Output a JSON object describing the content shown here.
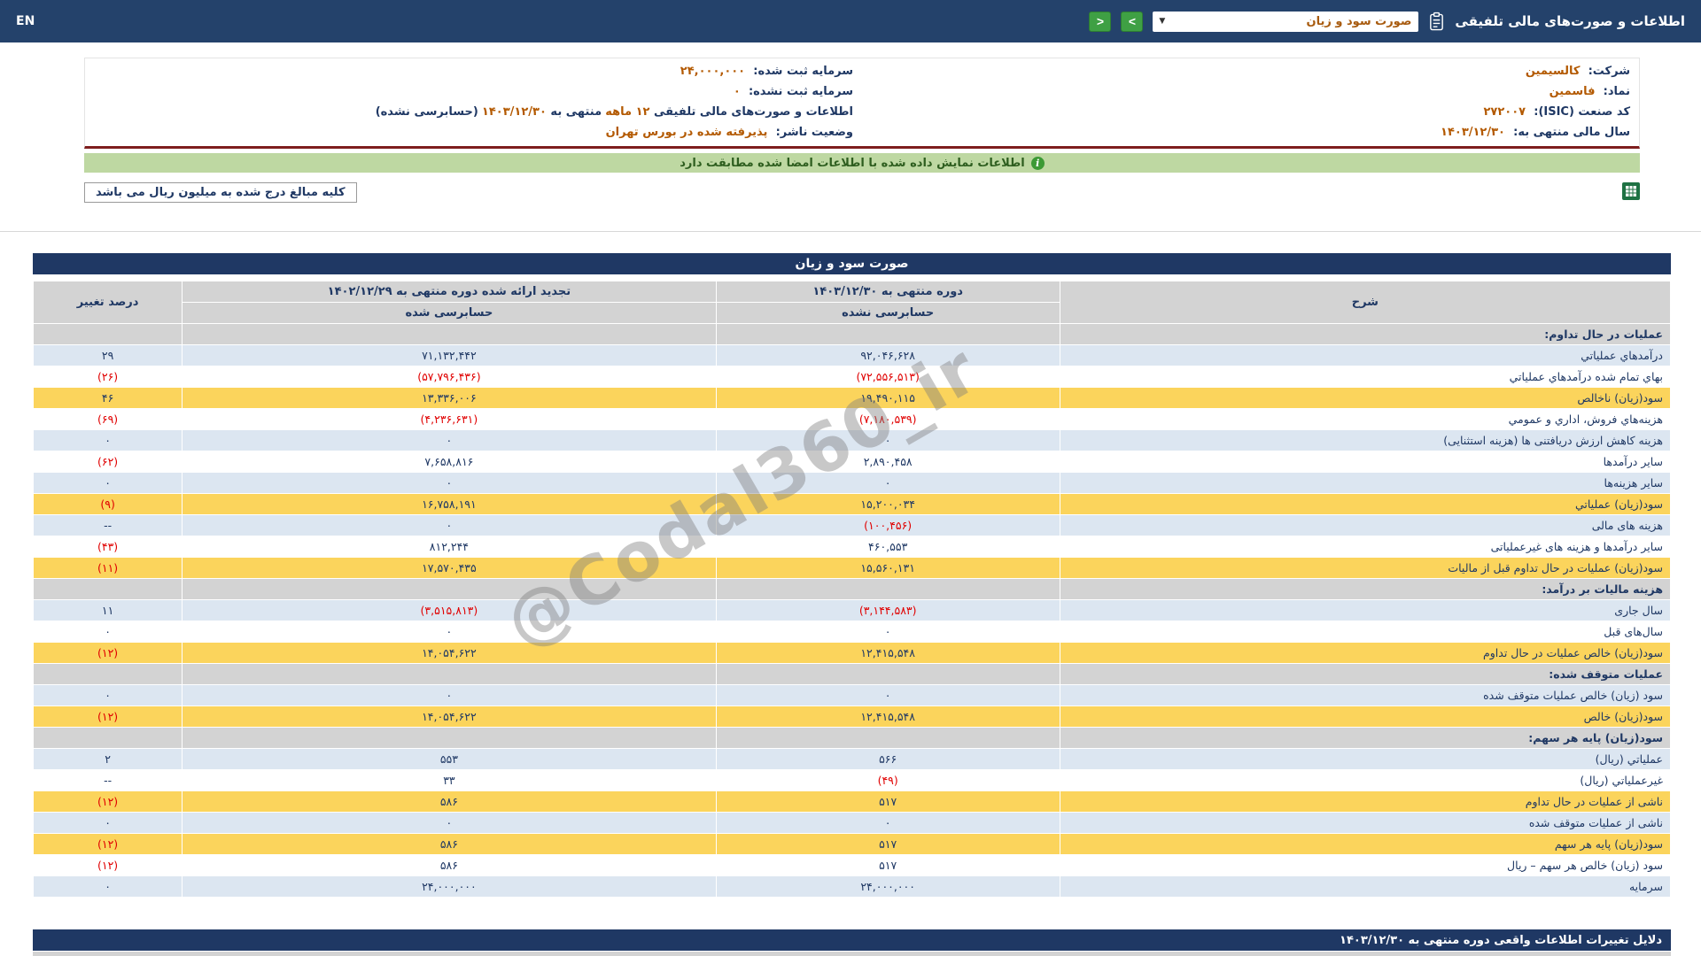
{
  "colors": {
    "navy_bar": "#1F3864",
    "topbar_navy": "#24426B",
    "accent_orange": "#B35900",
    "row_blue": "#DCE6F1",
    "row_yellow": "#FBD45C",
    "section_gray": "#D3D3D3",
    "negative_red": "#E00000",
    "banner_green_bg": "#BED8A2",
    "banner_green_text": "#2E5E1F",
    "maroon_line": "#7E1E1E",
    "button_green": "#3FA044"
  },
  "topbar": {
    "en_label": "EN",
    "title": "اطلاعات و صورت‌های مالی تلفیقی",
    "report_select_value": "صورت سود و زیان",
    "select_arrow_glyph": "▼",
    "next_glyph": ">",
    "prev_glyph": "<"
  },
  "company_info": {
    "right": {
      "r1": {
        "label": "شرکت:",
        "value": "کالسیمین"
      },
      "r2": {
        "label": "نماد:",
        "value": "فاسمین"
      },
      "r3": {
        "label": "کد صنعت (ISIC):",
        "value": "۲۷۲۰۰۷"
      },
      "r4": {
        "label": "سال مالی منتهی به:",
        "value": "۱۴۰۳/۱۲/۳۰"
      }
    },
    "left": {
      "r1": {
        "label": "سرمایه ثبت شده:",
        "value": "۲۴,۰۰۰,۰۰۰"
      },
      "r2": {
        "label": "سرمایه ثبت نشده:",
        "value": "۰"
      },
      "r3": {
        "p1": "اطلاعات و صورت‌های مالی تلفیقی ",
        "p2": "۱۲ ماهه",
        "p3": " منتهی به ",
        "p4": "۱۴۰۳/۱۲/۳۰",
        "p5": "(حسابرسی نشده)"
      },
      "r4": {
        "label": "وضعیت ناشر:",
        "value": "پذیرفته شده در بورس تهران"
      }
    }
  },
  "banner": {
    "icon_glyph": "i",
    "text": "اطلاعات نمایش داده شده با اطلاعات امضا شده مطابقت دارد"
  },
  "note": {
    "text": "کلیه مبالغ درج شده به میلیون ریال می باشد"
  },
  "watermark": {
    "text": "@Codal360_ir"
  },
  "table": {
    "title": "صورت سود و زیان",
    "columns": {
      "desc": "شرح",
      "current": "دوره منتهی به ۱۴۰۳/۱۲/۳۰",
      "current_sub": "حسابرسی نشده",
      "restated": "تجدید ارائه شده دوره منتهی به ۱۴۰۲/۱۲/۲۹",
      "restated_sub": "حسابرسی شده",
      "change": "درصد تغییر"
    },
    "rows": [
      {
        "type": "section",
        "label": "عملیات در حال تداوم:",
        "current": "",
        "restated": "",
        "change": ""
      },
      {
        "type": "blue",
        "label": "درآمدهاي عملياتي",
        "current": "۹۲,۰۴۶,۶۲۸",
        "restated": "۷۱,۱۳۲,۴۴۲",
        "change": "۲۹"
      },
      {
        "type": "white",
        "label": "بهاي تمام شده درآمدهاي عملياتي",
        "current": "(۷۲,۵۵۶,۵۱۳)",
        "restated": "(۵۷,۷۹۶,۴۳۶)",
        "change": "(۲۶)"
      },
      {
        "type": "yellow",
        "label": "سود(زيان) ناخالص",
        "current": "۱۹,۴۹۰,۱۱۵",
        "restated": "۱۳,۳۳۶,۰۰۶",
        "change": "۴۶"
      },
      {
        "type": "white",
        "label": "هزينه‌هاي فروش، اداري و عمومي",
        "current": "(۷,۱۸۰,۵۳۹)",
        "restated": "(۴,۲۳۶,۶۳۱)",
        "change": "(۶۹)"
      },
      {
        "type": "blue",
        "label": "هزینه کاهش ارزش دریافتنی ها (هزینه استثنایی)",
        "current": "۰",
        "restated": "۰",
        "change": "۰"
      },
      {
        "type": "white",
        "label": "سایر درآمدها",
        "current": "۲,۸۹۰,۴۵۸",
        "restated": "۷,۶۵۸,۸۱۶",
        "change": "(۶۲)"
      },
      {
        "type": "blue",
        "label": "سایر هزینه‌ها",
        "current": "۰",
        "restated": "۰",
        "change": "۰"
      },
      {
        "type": "yellow",
        "label": "سود(زيان) عملياتي",
        "current": "۱۵,۲۰۰,۰۳۴",
        "restated": "۱۶,۷۵۸,۱۹۱",
        "change": "(۹)"
      },
      {
        "type": "blue",
        "label": "هزینه های مالی",
        "current": "(۱۰۰,۴۵۶)",
        "restated": "۰",
        "change": "--"
      },
      {
        "type": "white",
        "label": "سایر درآمدها و هزینه های غیرعملیاتی",
        "current": "۴۶۰,۵۵۳",
        "restated": "۸۱۲,۲۴۴",
        "change": "(۴۳)"
      },
      {
        "type": "yellow",
        "label": "سود(زیان) عملیات در حال تداوم قبل از مالیات",
        "current": "۱۵,۵۶۰,۱۳۱",
        "restated": "۱۷,۵۷۰,۴۳۵",
        "change": "(۱۱)"
      },
      {
        "type": "section",
        "label": "هزینه مالیات بر درآمد:",
        "current": "",
        "restated": "",
        "change": ""
      },
      {
        "type": "blue",
        "label": "سال جاری",
        "current": "(۳,۱۴۴,۵۸۳)",
        "restated": "(۳,۵۱۵,۸۱۳)",
        "change": "۱۱"
      },
      {
        "type": "white",
        "label": "سال‌های قبل",
        "current": "۰",
        "restated": "۰",
        "change": "۰"
      },
      {
        "type": "yellow",
        "label": "سود(زیان) خالص عملیات در حال تداوم",
        "current": "۱۲,۴۱۵,۵۴۸",
        "restated": "۱۴,۰۵۴,۶۲۲",
        "change": "(۱۲)"
      },
      {
        "type": "section",
        "label": "عملیات متوقف شده:",
        "current": "",
        "restated": "",
        "change": ""
      },
      {
        "type": "blue",
        "label": "سود (زیان) خالص عملیات متوقف شده",
        "current": "۰",
        "restated": "۰",
        "change": "۰"
      },
      {
        "type": "yellow",
        "label": "سود(زیان) خالص",
        "current": "۱۲,۴۱۵,۵۴۸",
        "restated": "۱۴,۰۵۴,۶۲۲",
        "change": "(۱۲)"
      },
      {
        "type": "section",
        "label": "سود(زیان) پایه هر سهم:",
        "current": "",
        "restated": "",
        "change": ""
      },
      {
        "type": "blue",
        "label": "عملیاتي (ریال)",
        "current": "۵۶۶",
        "restated": "۵۵۳",
        "change": "۲"
      },
      {
        "type": "white",
        "label": "غیرعملیاتي (ریال)",
        "current": "(۴۹)",
        "restated": "۳۳",
        "change": "--"
      },
      {
        "type": "yellow",
        "label": "ناشی از عملیات در حال تداوم",
        "current": "۵۱۷",
        "restated": "۵۸۶",
        "change": "(۱۲)"
      },
      {
        "type": "blue",
        "label": "ناشی از عملیات متوقف شده",
        "current": "۰",
        "restated": "۰",
        "change": "۰"
      },
      {
        "type": "yellow",
        "label": "سود(زیان) پایه هر سهم",
        "current": "۵۱۷",
        "restated": "۵۸۶",
        "change": "(۱۲)"
      },
      {
        "type": "white",
        "label": "سود (زیان) خالص هر سهم – ریال",
        "current": "۵۱۷",
        "restated": "۵۸۶",
        "change": "(۱۲)"
      },
      {
        "type": "blue",
        "label": "سرمایه",
        "current": "۲۴,۰۰۰,۰۰۰",
        "restated": "۲۴,۰۰۰,۰۰۰",
        "change": "۰"
      }
    ]
  },
  "footer": {
    "title": "دلایل تغییرات اطلاعات واقعی دوره منتهی به ۱۴۰۳/۱۲/۳۰"
  }
}
